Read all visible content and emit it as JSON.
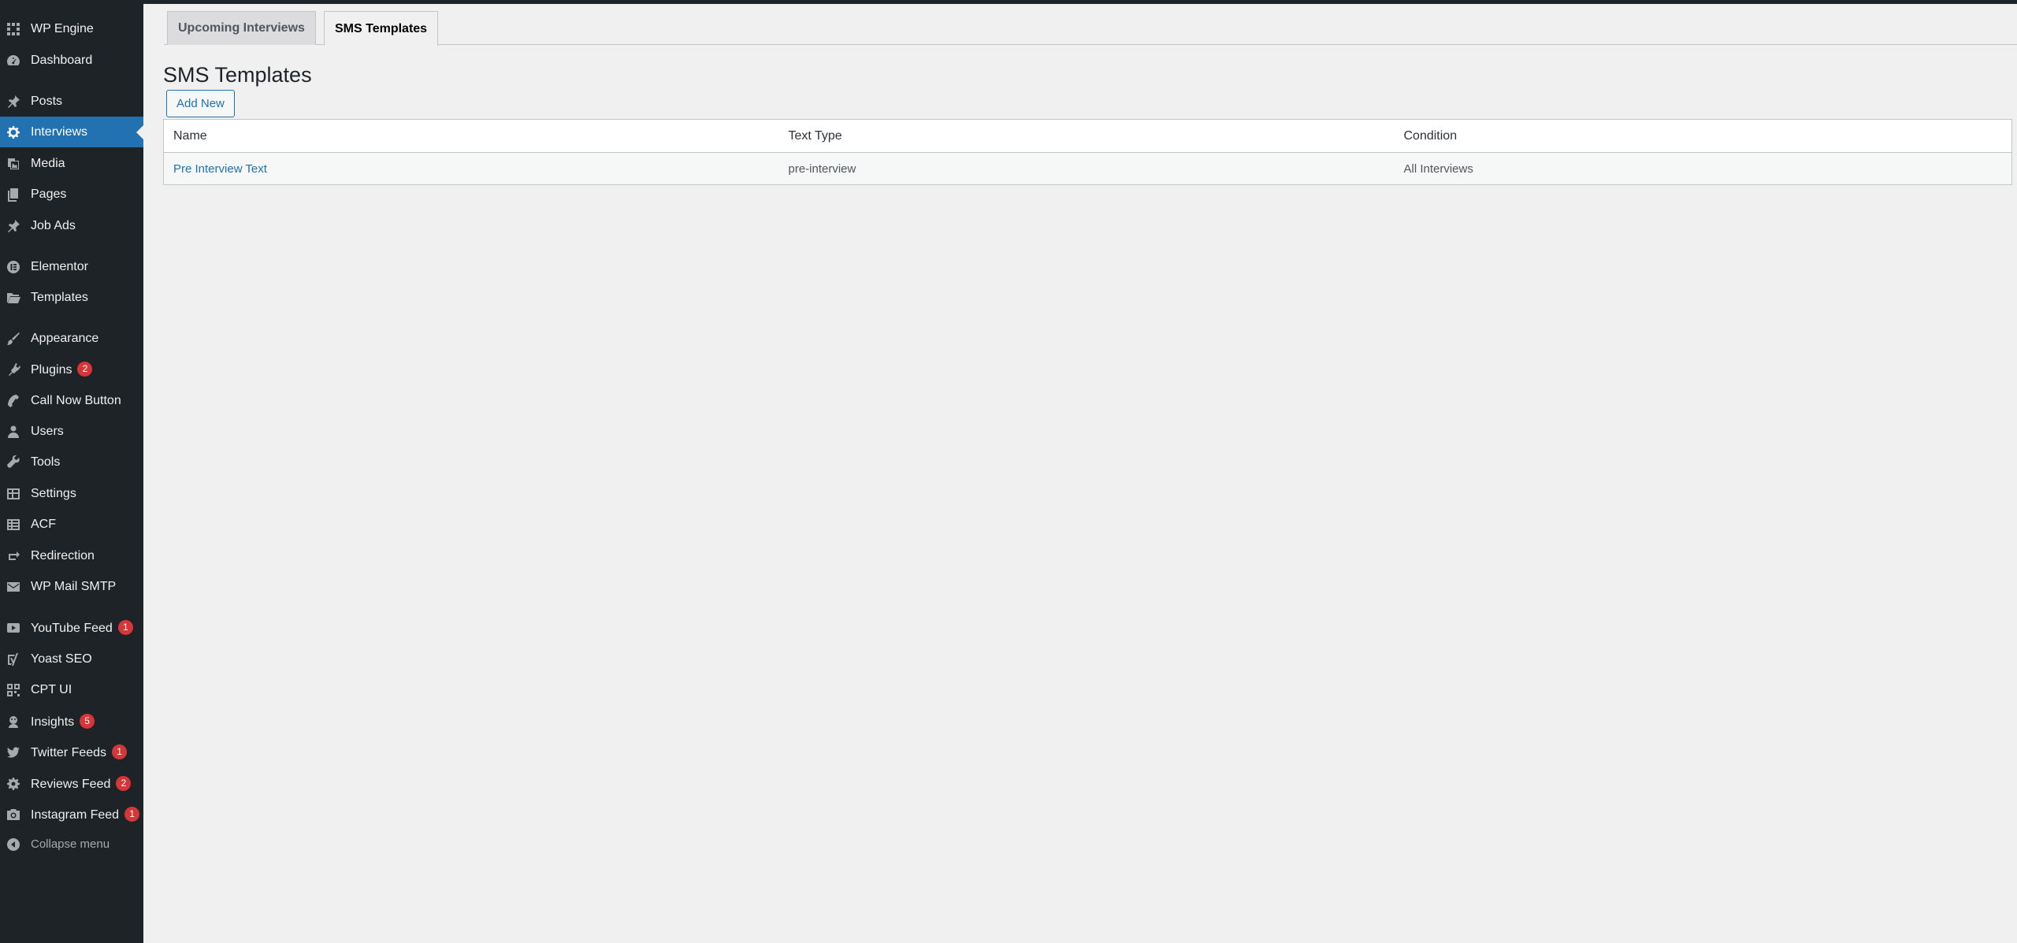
{
  "sidebar": {
    "items": [
      {
        "label": "WP Engine",
        "icon": "wpengine-icon"
      },
      {
        "label": "Dashboard",
        "icon": "dashboard-icon"
      },
      {
        "label": "Posts",
        "icon": "pin-icon"
      },
      {
        "label": "Interviews",
        "icon": "gear-icon",
        "current": true
      },
      {
        "label": "Media",
        "icon": "media-icon"
      },
      {
        "label": "Pages",
        "icon": "pages-icon"
      },
      {
        "label": "Job Ads",
        "icon": "pin-icon"
      },
      {
        "label": "Elementor",
        "icon": "elementor-icon"
      },
      {
        "label": "Templates",
        "icon": "folder-icon"
      },
      {
        "label": "Appearance",
        "icon": "brush-icon"
      },
      {
        "label": "Plugins",
        "icon": "plugin-icon",
        "badge": "2"
      },
      {
        "label": "Call Now Button",
        "icon": "phone-icon"
      },
      {
        "label": "Users",
        "icon": "user-icon"
      },
      {
        "label": "Tools",
        "icon": "wrench-icon"
      },
      {
        "label": "Settings",
        "icon": "settings-icon"
      },
      {
        "label": "ACF",
        "icon": "grid-icon"
      },
      {
        "label": "Redirection",
        "icon": "redirect-icon"
      },
      {
        "label": "WP Mail SMTP",
        "icon": "mail-icon"
      },
      {
        "label": "YouTube Feed",
        "icon": "youtube-icon",
        "badge": "1"
      },
      {
        "label": "Yoast SEO",
        "icon": "yoast-icon"
      },
      {
        "label": "CPT UI",
        "icon": "cpt-icon"
      },
      {
        "label": "Insights",
        "icon": "insights-icon",
        "badge": "5"
      },
      {
        "label": "Twitter Feeds",
        "icon": "twitter-icon",
        "badge": "1"
      },
      {
        "label": "Reviews Feed",
        "icon": "reviews-icon",
        "badge": "2"
      },
      {
        "label": "Instagram Feed",
        "icon": "camera-icon",
        "badge": "1"
      }
    ],
    "collapse_label": "Collapse menu"
  },
  "tabs": [
    {
      "label": "Upcoming Interviews",
      "active": false
    },
    {
      "label": "SMS Templates",
      "active": true
    }
  ],
  "main": {
    "title": "SMS Templates",
    "add_new_label": "Add New",
    "table": {
      "headers": [
        "Name",
        "Text Type",
        "Condition"
      ],
      "rows": [
        {
          "name": "Pre Interview Text",
          "text_type": "pre-interview",
          "condition": "All Interviews"
        }
      ]
    }
  },
  "colors": {
    "sidebar_bg": "#1d2327",
    "accent": "#2271b1",
    "badge": "#d63638",
    "page_bg": "#f0f0f1"
  }
}
